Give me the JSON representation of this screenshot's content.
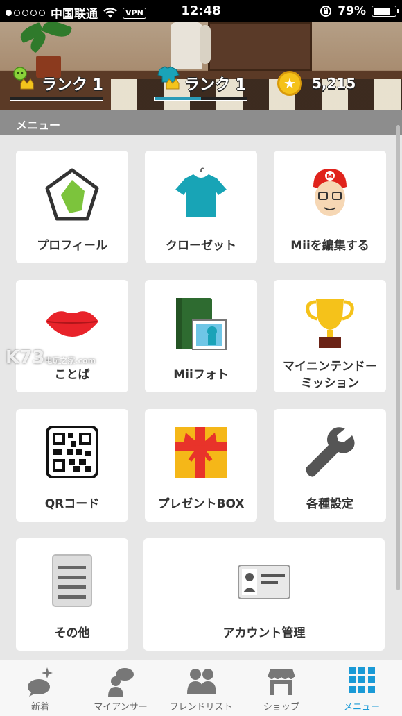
{
  "status_bar": {
    "carrier": "中国联通",
    "vpn": "VPN",
    "time": "12:48",
    "battery": "79%",
    "signal_bars": 1
  },
  "header": {
    "rank_left": "ランク 1",
    "rank_right": "ランク 1",
    "rank_right_progress": 0.5,
    "coins": "5,215"
  },
  "section_title": "メニュー",
  "menu": {
    "profile": "プロフィール",
    "closet": "クローゼット",
    "mii_edit": "Miiを編集する",
    "kotoba": "ことば",
    "mii_photo": "Miiフォト",
    "mission_brand": "マイニンテンドー",
    "mission": "ミッション",
    "qr": "QRコード",
    "present": "プレゼントBOX",
    "settings": "各種設定",
    "other": "その他",
    "account": "アカウント管理"
  },
  "watermark": {
    "main": "K73",
    "sub1": "电玩之家",
    "sub2": ".com"
  },
  "tabs": {
    "news": "新着",
    "my_answer": "マイアンサー",
    "friends": "フレンドリスト",
    "shop": "ショップ",
    "menu": "メニュー"
  },
  "colors": {
    "accent": "#1a9ad6",
    "mission_red": "#e8402a",
    "section_bar": "#8d8d8d"
  }
}
